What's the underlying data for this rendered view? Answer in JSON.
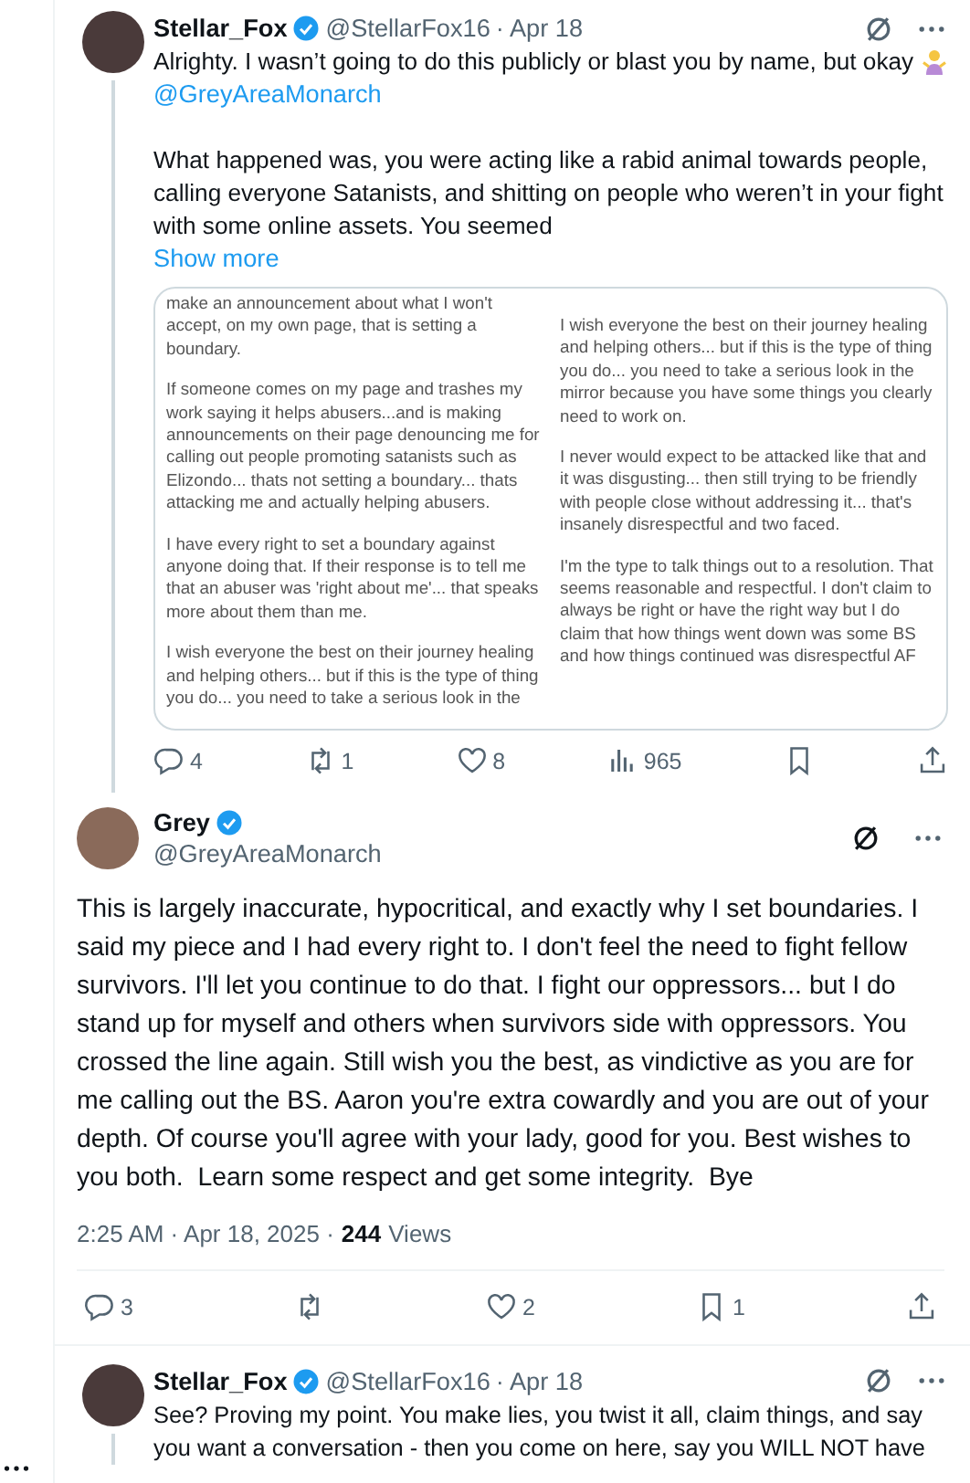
{
  "reply": {
    "author": "Stellar_Fox",
    "verified": true,
    "handle": "@StellarFox16",
    "date": "· Apr 18",
    "paragraphs": [
      "Alrighty. I wasn’t going to do this publicly or blast you by name, but okay",
      "What happened was, you were acting like a rabid animal towards people, calling everyone Satanists, and shitting on people who weren’t in your fight with some online assets. You seemed"
    ],
    "mention": "@GreyAreaMonarch",
    "show_more": "Show more",
    "image_columns": [
      [
        "make an announcement about what I won't accept, on my own page, that is setting a boundary.",
        "If someone comes on my page and trashes my work saying it helps abusers...and is making announcements on their page denouncing me for calling out people promoting satanists such as Elizondo... thats not setting a boundary... thats attacking me and actually helping abusers.",
        "I have every right to set a boundary against anyone doing that. If their response is to tell me that an abuser was 'right about me'... that speaks more about them than me.",
        "I wish everyone the best on their journey healing and helping others... but if this is the type of thing you do... you need to take a serious look in the"
      ],
      [
        "I wish everyone the best on their journey healing and helping others... but if this is the type of thing you do... you need to take a serious look in the mirror because you have some things you clearly need to work on.",
        "I never would expect to be attacked like that and it was disgusting... then still trying to be friendly with people close without addressing it... that's insanely disrespectful and two faced.",
        "I'm the type to talk things out to a resolution. That seems reasonable and respectful. I don't claim to always be right or have the right way but I do claim that how things went down was some BS and how things continued was disrespectful AF"
      ]
    ],
    "actions": [
      {
        "kind": "reply",
        "count": "4"
      },
      {
        "kind": "repost",
        "count": "1"
      },
      {
        "kind": "like",
        "count": "8"
      },
      {
        "kind": "views",
        "count": "965"
      },
      {
        "kind": "bookmark"
      },
      {
        "kind": "share"
      }
    ]
  },
  "focused": {
    "author": "Grey",
    "verified": true,
    "handle": "@GreyAreaMonarch",
    "text": "This is largely inaccurate, hypocritical, and exactly why I set boundaries. I said my piece and I had every right to. I don't feel the need to fight fellow survivors. I'll let you continue to do that. I fight our oppressors... but I do stand up for myself and others when survivors side with oppressors. You crossed the line again. Still wish you the best, as vindictive as you are for me calling out the BS. Aaron you're extra cowardly and you are out of your depth. Of course you'll agree with your lady, good for you. Best wishes to you both.  Learn some respect and get some integrity.  Bye",
    "timestamp": "2:25 AM · Apr 18, 2025 ·",
    "views_count": "244",
    "views_label": "Views",
    "actions": [
      {
        "kind": "reply",
        "count": "3"
      },
      {
        "kind": "repost"
      },
      {
        "kind": "like",
        "count": "2"
      },
      {
        "kind": "bookmark",
        "count": "1"
      },
      {
        "kind": "share"
      }
    ]
  },
  "next_reply": {
    "author": "Stellar_Fox",
    "verified": true,
    "handle": "@StellarFox16",
    "date": "· Apr 18",
    "text": "See? Proving my point. You make lies, you twist it all, claim things, and say you want a conversation - then you come on here, say you WILL NOT have"
  }
}
